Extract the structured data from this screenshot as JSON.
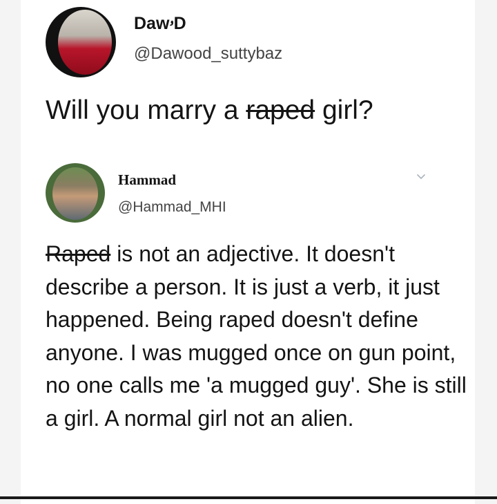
{
  "tweet": {
    "author_name": "DawۥD",
    "author_handle": "@Dawood_suttybaz",
    "text_before": "Will you marry a ",
    "text_struck": "raped",
    "text_after": " girl?"
  },
  "reply": {
    "author_name": "Hammad",
    "author_handle": "@Hammad_MHI",
    "text_struck": "Raped",
    "text_rest": " is not an adjective. It doesn't describe a person. It is just a verb, it just happened. Being raped doesn't define anyone. I was mugged once on gun point, no one calls me 'a mugged guy'. She is still a girl. A normal girl not an alien."
  },
  "icons": {
    "menu": "chevron-down-icon"
  },
  "colors": {
    "background": "#f4f4f4",
    "card": "#ffffff",
    "text": "#141414",
    "handle": "#444444"
  }
}
